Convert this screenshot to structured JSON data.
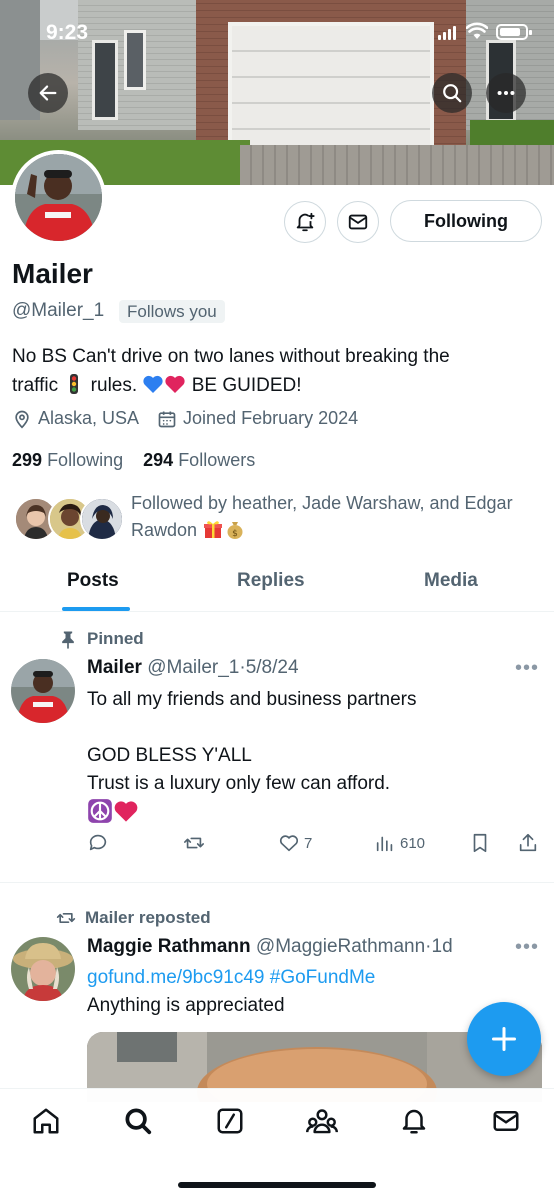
{
  "status_bar": {
    "time": "9:23"
  },
  "profile": {
    "name": "Mailer",
    "handle": "@Mailer_1",
    "follows_you_label": "Follows you",
    "following_button_label": "Following",
    "bio_line1": "No BS Can't drive on two lanes without breaking the",
    "bio_line2_a": "traffic",
    "bio_line2_b": "rules.",
    "bio_line2_c": "BE GUIDED!",
    "location": "Alaska, USA",
    "joined": "Joined February 2024",
    "following_count": "299",
    "following_label": "Following",
    "followers_count": "294",
    "followers_label": "Followers",
    "followed_by_text": "Followed by heather, Jade Warshaw, and Edgar Rawdon"
  },
  "tabs": [
    {
      "label": "Posts",
      "active": true
    },
    {
      "label": "Replies",
      "active": false
    },
    {
      "label": "Media",
      "active": false
    }
  ],
  "pinned_post": {
    "social_label": "Pinned",
    "author": "Mailer",
    "handle": "@Mailer_1",
    "dot": "·",
    "date": "5/8/24",
    "line1": "To all my friends and business partners",
    "line2": "GOD BLESS Y'ALL",
    "line3": "Trust is a luxury only few can afford.",
    "likes": "7",
    "views": "610"
  },
  "repost": {
    "social_label": "Mailer reposted",
    "author": "Maggie Rathmann",
    "handle": "@MaggieRathmann",
    "dot": "·",
    "time": "1d",
    "link1": "gofund.me/9bc91c49",
    "hashtag": "#GoFundMe",
    "line2": "Anything is appreciated"
  },
  "colors": {
    "accent": "#1d9bf0",
    "text": "#0f1419",
    "secondary": "#536471"
  },
  "icons": [
    "back-arrow-icon",
    "search-icon",
    "more-icon",
    "notification-bell-plus-icon",
    "mail-icon",
    "location-pin-icon",
    "calendar-icon",
    "pin-icon",
    "reply-icon",
    "retweet-icon",
    "like-icon",
    "views-icon",
    "bookmark-icon",
    "share-icon",
    "compose-plus-icon",
    "home-icon",
    "explore-icon",
    "grok-icon",
    "communities-icon",
    "notifications-icon",
    "messages-icon"
  ]
}
